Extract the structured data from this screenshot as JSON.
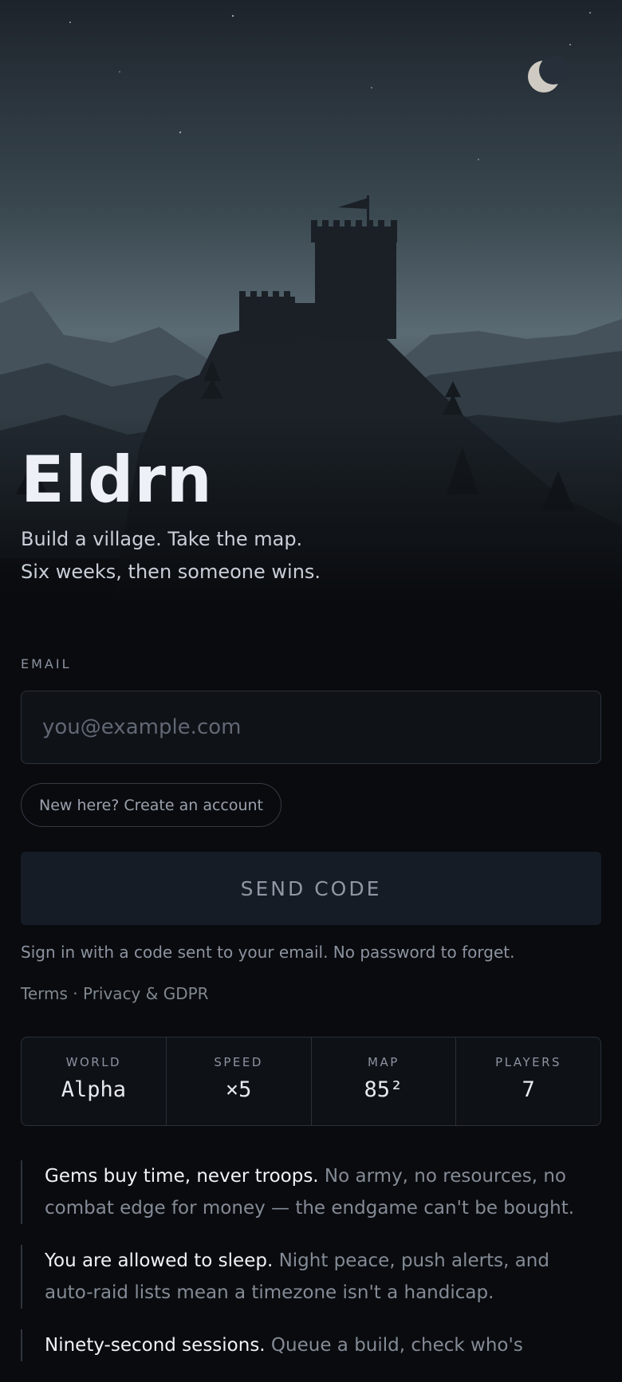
{
  "app": {
    "title": "Eldrn",
    "tagline": [
      "Build a village. Take the map.",
      "Six weeks, then someone wins."
    ]
  },
  "form": {
    "email_label": "EMAIL",
    "email_value": "",
    "email_placeholder": "you@example.com",
    "create_account_label": "New here? Create an account",
    "send_label": "SEND CODE",
    "note": "Sign in with a code sent to your email. No password to forget."
  },
  "legal": {
    "terms": "Terms",
    "separator": " · ",
    "privacy": "Privacy & GDPR"
  },
  "stats": [
    {
      "label": "WORLD",
      "value": "Alpha"
    },
    {
      "label": "SPEED",
      "value": "×5"
    },
    {
      "label": "MAP",
      "value": "85²"
    },
    {
      "label": "PLAYERS",
      "value": "7"
    }
  ],
  "features": [
    {
      "title": "Gems buy time, never troops.",
      "text": " No army, no resources, no combat edge for money — the endgame can't be bought."
    },
    {
      "title": "You are allowed to sleep.",
      "text": " Night peace, push alerts, and auto-raid lists mean a timezone isn't a handicap."
    },
    {
      "title": "Ninety-second sessions.",
      "text": " Queue a build, check who's"
    }
  ],
  "icons": {
    "moon": "crescent-moon-icon",
    "castle": "castle-illustration"
  },
  "colors": {
    "background": "#090b0e",
    "sky_top": "#1f262e",
    "sky_horizon": "#5a6a72"
  }
}
